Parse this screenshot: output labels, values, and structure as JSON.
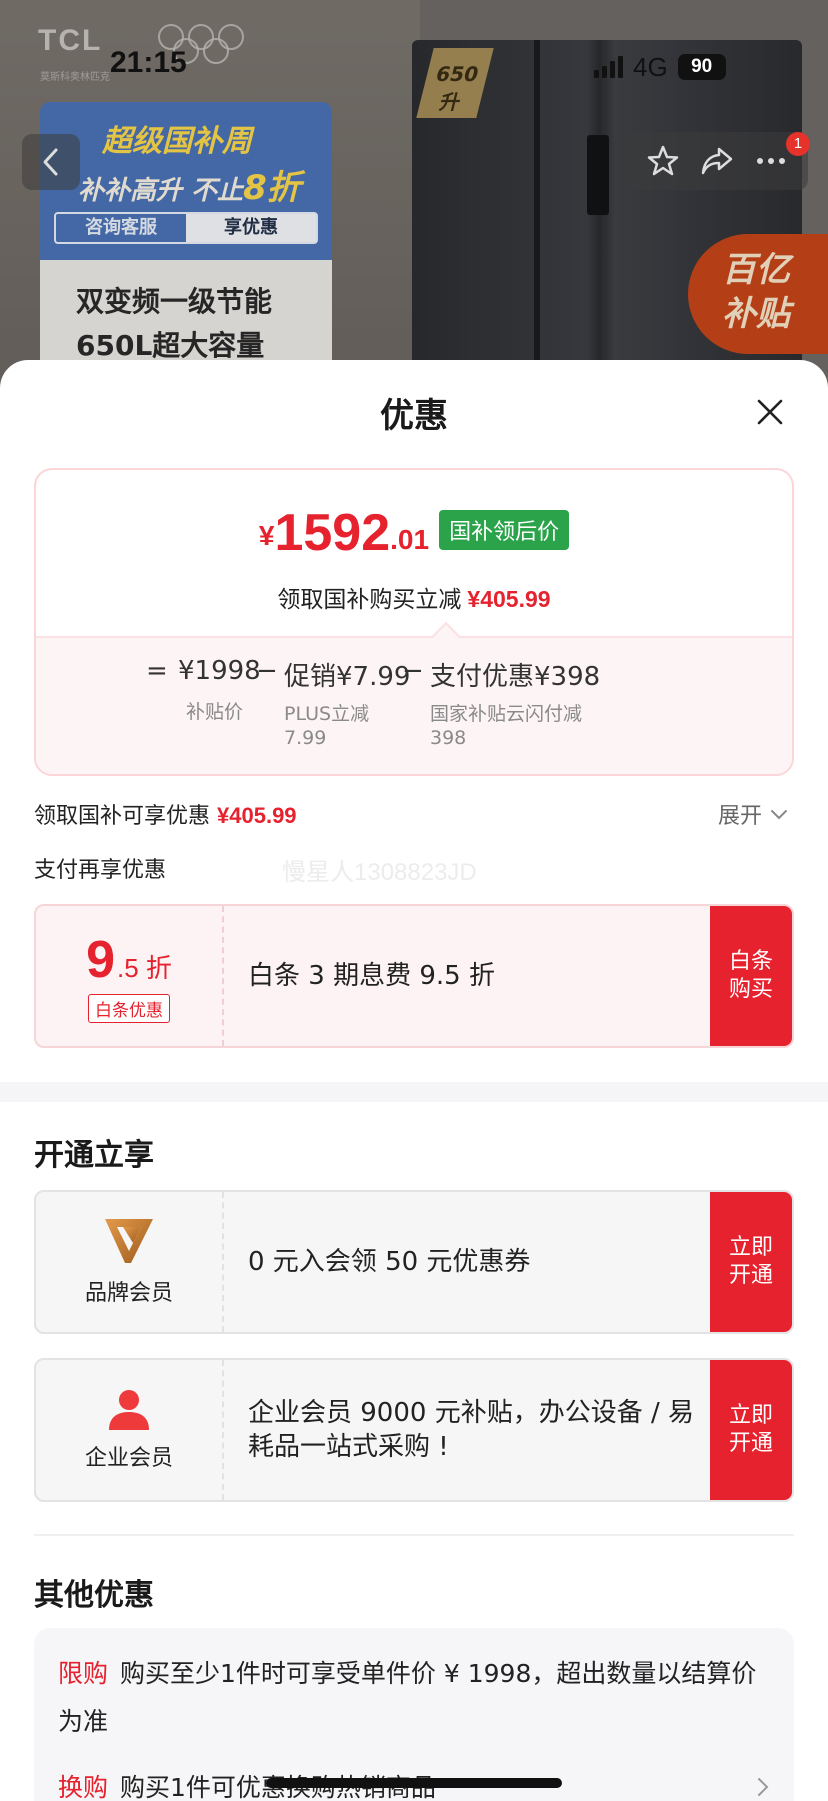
{
  "status": {
    "time": "21:15",
    "network": "4G",
    "battery": "90"
  },
  "background": {
    "brand": "TCL",
    "brand_sub": "莫斯科奥林匹克",
    "ribbon": "650升",
    "promo_title": "超级国补周",
    "promo_sub_a": "补补高升 不止",
    "promo_sub_b": "8折",
    "btn_consult": "咨询客服",
    "btn_offer": "享优惠",
    "feature_1": "双变频一级节能",
    "feature_2": "650L超大容量",
    "subsidy_1": "百亿",
    "subsidy_2": "补贴"
  },
  "nav": {
    "cart_badge": "1"
  },
  "sheet": {
    "title": "优惠",
    "price": {
      "symbol": "¥",
      "integer": "1592",
      "decimal": ".01",
      "tag": "国补领后价"
    },
    "price_sub_label": "领取国补购买立减",
    "price_sub_amount": "¥405.99",
    "formula": {
      "eq": "=",
      "base_value": "¥1998",
      "base_label": "补贴价",
      "minus1": "−",
      "promo_value": "促销¥7.99",
      "promo_label_1": "PLUS立减",
      "promo_label_2": "7.99",
      "minus2": "−",
      "pay_value": "支付优惠¥398",
      "pay_label_1": "国家补贴云闪付减",
      "pay_label_2": "398"
    },
    "claim_label": "领取国补可享优惠",
    "claim_amount": "¥405.99",
    "expand_label": "展开",
    "pay_more_label": "支付再享优惠",
    "watermark": "慢星人1308823JD",
    "baitiao": {
      "discount_big": "9",
      "discount_small": ".5 折",
      "tag": "白条优惠",
      "desc": "白条 3 期息费 9.5 折",
      "button": "白条\n购买"
    },
    "open_section_title": "开通立享",
    "brand_member": {
      "label": "品牌会员",
      "desc": "0 元入会领 50 元优惠券",
      "button": "立即\n开通"
    },
    "enterprise_member": {
      "label": "企业会员",
      "desc": "企业会员 9000 元补贴，办公设备 / 易耗品一站式采购 !",
      "button": "立即\n开通"
    },
    "other_section_title": "其他优惠",
    "other": {
      "limit_tag": "限购",
      "limit_text": "购买至少1件时可享受单件价 ¥ 1998，超出数量以结算价为准",
      "swap_tag": "换购",
      "swap_text": "购买1件可优惠换购热销商品"
    }
  },
  "colors": {
    "accent": "#e5222e",
    "green_tag": "#2aa34a"
  }
}
